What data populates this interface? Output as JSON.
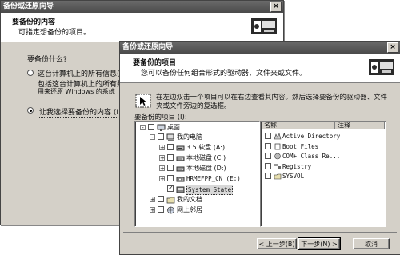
{
  "back_window": {
    "title": "备份或还原向导",
    "close": "×",
    "header_title": "要备份的内容",
    "header_subtitle": "可指定想备份的项目。",
    "question": "要备份什么?",
    "options": [
      {
        "label": "这台计算机上的所有信息",
        "key": "(A)",
        "selected": false
      },
      {
        "label": "让我选择要备份的内容",
        "key": "(L)",
        "selected": true
      }
    ],
    "desc_line1": "包括这台计算机上的所有数",
    "desc_line2": "用来还原 Windows 的系统"
  },
  "front_window": {
    "title": "备份或还原向导",
    "close": "×",
    "header_title": "要备份的项目",
    "header_subtitle": "您可以备份任何组合形式的驱动器、文件夹或文件。",
    "instruction_line1": "在左边双击一个项目可以在右边查看其内容。然后选择要备份的驱动器、文件",
    "instruction_line2": "夹或文件旁边的复选框。",
    "items_label": "要备份的项目 (I):",
    "tree": [
      {
        "label": "桌面",
        "expander": "-",
        "check": "",
        "icon": "desktop-icon"
      },
      {
        "label": "我的电脑",
        "expander": "-",
        "check": "",
        "icon": "my-computer-icon"
      },
      {
        "label": "3.5 软盘 (A:)",
        "expander": "+",
        "check": "",
        "icon": "floppy-drive-icon"
      },
      {
        "label": "本地磁盘 (C:)",
        "expander": "+",
        "check": "",
        "icon": "hard-disk-icon"
      },
      {
        "label": "本地磁盘 (D:)",
        "expander": "+",
        "check": "",
        "icon": "hard-disk-icon"
      },
      {
        "label": "HRMEFPP_CN (E:)",
        "expander": "+",
        "check": "",
        "icon": "cd-drive-icon"
      },
      {
        "label": "System State",
        "expander": "",
        "check": "✓",
        "icon": "system-state-icon"
      },
      {
        "label": "我的文档",
        "expander": "+",
        "check": "",
        "icon": "folder-icon"
      },
      {
        "label": "网上邻居",
        "expander": "+",
        "check": "",
        "icon": "network-icon"
      }
    ],
    "list_columns": [
      "名称",
      "注释"
    ],
    "list_items": [
      {
        "label": "Active Directory",
        "icon": "directory-icon"
      },
      {
        "label": "Boot Files",
        "icon": "file-icon"
      },
      {
        "label": "COM+ Class Re...",
        "icon": "component-icon"
      },
      {
        "label": "Registry",
        "icon": "registry-icon"
      },
      {
        "label": "SYSVOL",
        "icon": "share-icon"
      }
    ],
    "buttons": {
      "back": "< 上一步(B)",
      "next": "下一步(N) >",
      "cancel": "取消"
    }
  }
}
